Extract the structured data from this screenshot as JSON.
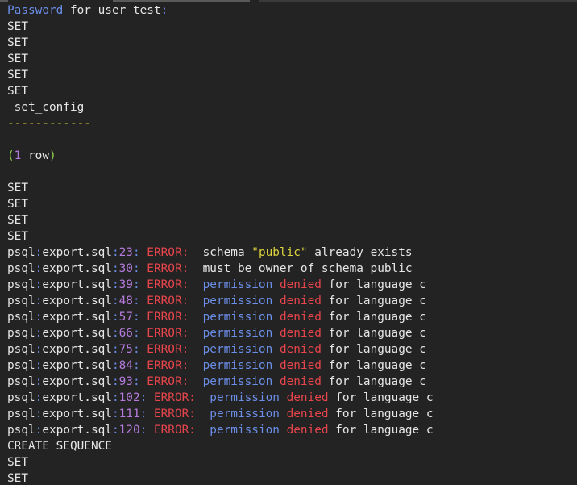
{
  "colors": {
    "background": "#232323",
    "text": "#e6e6e6",
    "keyword_blue": "#6b8ee8",
    "error_red": "#e8454c",
    "number_purple": "#b57bdc",
    "string_yellow": "#d9d23c",
    "paren_green": "#8fd14f"
  },
  "terminal": {
    "lines": [
      [
        {
          "t": "Password",
          "c": "blue"
        },
        {
          "t": " for user test",
          "c": "white"
        },
        {
          "t": ":",
          "c": "blue"
        }
      ],
      [
        {
          "t": "SET",
          "c": "white"
        }
      ],
      [
        {
          "t": "SET",
          "c": "white"
        }
      ],
      [
        {
          "t": "SET",
          "c": "white"
        }
      ],
      [
        {
          "t": "SET",
          "c": "white"
        }
      ],
      [
        {
          "t": "SET",
          "c": "white"
        }
      ],
      [
        {
          "t": " set_config",
          "c": "white"
        }
      ],
      [
        {
          "t": "------------",
          "c": "yellow"
        }
      ],
      [
        {
          "t": " ",
          "c": "white"
        }
      ],
      [
        {
          "t": "(",
          "c": "green"
        },
        {
          "t": "1",
          "c": "purple"
        },
        {
          "t": " row",
          "c": "white"
        },
        {
          "t": ")",
          "c": "green"
        }
      ],
      [
        {
          "t": " ",
          "c": "white"
        }
      ],
      [
        {
          "t": "SET",
          "c": "white"
        }
      ],
      [
        {
          "t": "SET",
          "c": "white"
        }
      ],
      [
        {
          "t": "SET",
          "c": "white"
        }
      ],
      [
        {
          "t": "SET",
          "c": "white"
        }
      ],
      [
        {
          "t": "psql",
          "c": "white"
        },
        {
          "t": ":",
          "c": "blue"
        },
        {
          "t": "export.sql",
          "c": "white"
        },
        {
          "t": ":",
          "c": "blue"
        },
        {
          "t": "23",
          "c": "purple"
        },
        {
          "t": ": ",
          "c": "blue"
        },
        {
          "t": "ERROR",
          "c": "red"
        },
        {
          "t": ":  ",
          "c": "red"
        },
        {
          "t": "schema ",
          "c": "white"
        },
        {
          "t": "\"public\"",
          "c": "yellow"
        },
        {
          "t": " already exists",
          "c": "white"
        }
      ],
      [
        {
          "t": "psql",
          "c": "white"
        },
        {
          "t": ":",
          "c": "blue"
        },
        {
          "t": "export.sql",
          "c": "white"
        },
        {
          "t": ":",
          "c": "blue"
        },
        {
          "t": "30",
          "c": "purple"
        },
        {
          "t": ": ",
          "c": "blue"
        },
        {
          "t": "ERROR",
          "c": "red"
        },
        {
          "t": ":  ",
          "c": "red"
        },
        {
          "t": "must be owner of schema public",
          "c": "white"
        }
      ],
      [
        {
          "t": "psql",
          "c": "white"
        },
        {
          "t": ":",
          "c": "blue"
        },
        {
          "t": "export.sql",
          "c": "white"
        },
        {
          "t": ":",
          "c": "blue"
        },
        {
          "t": "39",
          "c": "purple"
        },
        {
          "t": ": ",
          "c": "blue"
        },
        {
          "t": "ERROR",
          "c": "red"
        },
        {
          "t": ":  ",
          "c": "red"
        },
        {
          "t": "permission",
          "c": "blue"
        },
        {
          "t": " ",
          "c": "white"
        },
        {
          "t": "denied",
          "c": "red"
        },
        {
          "t": " for language c",
          "c": "white"
        }
      ],
      [
        {
          "t": "psql",
          "c": "white"
        },
        {
          "t": ":",
          "c": "blue"
        },
        {
          "t": "export.sql",
          "c": "white"
        },
        {
          "t": ":",
          "c": "blue"
        },
        {
          "t": "48",
          "c": "purple"
        },
        {
          "t": ": ",
          "c": "blue"
        },
        {
          "t": "ERROR",
          "c": "red"
        },
        {
          "t": ":  ",
          "c": "red"
        },
        {
          "t": "permission",
          "c": "blue"
        },
        {
          "t": " ",
          "c": "white"
        },
        {
          "t": "denied",
          "c": "red"
        },
        {
          "t": " for language c",
          "c": "white"
        }
      ],
      [
        {
          "t": "psql",
          "c": "white"
        },
        {
          "t": ":",
          "c": "blue"
        },
        {
          "t": "export.sql",
          "c": "white"
        },
        {
          "t": ":",
          "c": "blue"
        },
        {
          "t": "57",
          "c": "purple"
        },
        {
          "t": ": ",
          "c": "blue"
        },
        {
          "t": "ERROR",
          "c": "red"
        },
        {
          "t": ":  ",
          "c": "red"
        },
        {
          "t": "permission",
          "c": "blue"
        },
        {
          "t": " ",
          "c": "white"
        },
        {
          "t": "denied",
          "c": "red"
        },
        {
          "t": " for language c",
          "c": "white"
        }
      ],
      [
        {
          "t": "psql",
          "c": "white"
        },
        {
          "t": ":",
          "c": "blue"
        },
        {
          "t": "export.sql",
          "c": "white"
        },
        {
          "t": ":",
          "c": "blue"
        },
        {
          "t": "66",
          "c": "purple"
        },
        {
          "t": ": ",
          "c": "blue"
        },
        {
          "t": "ERROR",
          "c": "red"
        },
        {
          "t": ":  ",
          "c": "red"
        },
        {
          "t": "permission",
          "c": "blue"
        },
        {
          "t": " ",
          "c": "white"
        },
        {
          "t": "denied",
          "c": "red"
        },
        {
          "t": " for language c",
          "c": "white"
        }
      ],
      [
        {
          "t": "psql",
          "c": "white"
        },
        {
          "t": ":",
          "c": "blue"
        },
        {
          "t": "export.sql",
          "c": "white"
        },
        {
          "t": ":",
          "c": "blue"
        },
        {
          "t": "75",
          "c": "purple"
        },
        {
          "t": ": ",
          "c": "blue"
        },
        {
          "t": "ERROR",
          "c": "red"
        },
        {
          "t": ":  ",
          "c": "red"
        },
        {
          "t": "permission",
          "c": "blue"
        },
        {
          "t": " ",
          "c": "white"
        },
        {
          "t": "denied",
          "c": "red"
        },
        {
          "t": " for language c",
          "c": "white"
        }
      ],
      [
        {
          "t": "psql",
          "c": "white"
        },
        {
          "t": ":",
          "c": "blue"
        },
        {
          "t": "export.sql",
          "c": "white"
        },
        {
          "t": ":",
          "c": "blue"
        },
        {
          "t": "84",
          "c": "purple"
        },
        {
          "t": ": ",
          "c": "blue"
        },
        {
          "t": "ERROR",
          "c": "red"
        },
        {
          "t": ":  ",
          "c": "red"
        },
        {
          "t": "permission",
          "c": "blue"
        },
        {
          "t": " ",
          "c": "white"
        },
        {
          "t": "denied",
          "c": "red"
        },
        {
          "t": " for language c",
          "c": "white"
        }
      ],
      [
        {
          "t": "psql",
          "c": "white"
        },
        {
          "t": ":",
          "c": "blue"
        },
        {
          "t": "export.sql",
          "c": "white"
        },
        {
          "t": ":",
          "c": "blue"
        },
        {
          "t": "93",
          "c": "purple"
        },
        {
          "t": ": ",
          "c": "blue"
        },
        {
          "t": "ERROR",
          "c": "red"
        },
        {
          "t": ":  ",
          "c": "red"
        },
        {
          "t": "permission",
          "c": "blue"
        },
        {
          "t": " ",
          "c": "white"
        },
        {
          "t": "denied",
          "c": "red"
        },
        {
          "t": " for language c",
          "c": "white"
        }
      ],
      [
        {
          "t": "psql",
          "c": "white"
        },
        {
          "t": ":",
          "c": "blue"
        },
        {
          "t": "export.sql",
          "c": "white"
        },
        {
          "t": ":",
          "c": "blue"
        },
        {
          "t": "102",
          "c": "purple"
        },
        {
          "t": ": ",
          "c": "blue"
        },
        {
          "t": "ERROR",
          "c": "red"
        },
        {
          "t": ":  ",
          "c": "red"
        },
        {
          "t": "permission",
          "c": "blue"
        },
        {
          "t": " ",
          "c": "white"
        },
        {
          "t": "denied",
          "c": "red"
        },
        {
          "t": " for language c",
          "c": "white"
        }
      ],
      [
        {
          "t": "psql",
          "c": "white"
        },
        {
          "t": ":",
          "c": "blue"
        },
        {
          "t": "export.sql",
          "c": "white"
        },
        {
          "t": ":",
          "c": "blue"
        },
        {
          "t": "111",
          "c": "purple"
        },
        {
          "t": ": ",
          "c": "blue"
        },
        {
          "t": "ERROR",
          "c": "red"
        },
        {
          "t": ":  ",
          "c": "red"
        },
        {
          "t": "permission",
          "c": "blue"
        },
        {
          "t": " ",
          "c": "white"
        },
        {
          "t": "denied",
          "c": "red"
        },
        {
          "t": " for language c",
          "c": "white"
        }
      ],
      [
        {
          "t": "psql",
          "c": "white"
        },
        {
          "t": ":",
          "c": "blue"
        },
        {
          "t": "export.sql",
          "c": "white"
        },
        {
          "t": ":",
          "c": "blue"
        },
        {
          "t": "120",
          "c": "purple"
        },
        {
          "t": ": ",
          "c": "blue"
        },
        {
          "t": "ERROR",
          "c": "red"
        },
        {
          "t": ":  ",
          "c": "red"
        },
        {
          "t": "permission",
          "c": "blue"
        },
        {
          "t": " ",
          "c": "white"
        },
        {
          "t": "denied",
          "c": "red"
        },
        {
          "t": " for language c",
          "c": "white"
        }
      ],
      [
        {
          "t": "CREATE SEQUENCE",
          "c": "white"
        }
      ],
      [
        {
          "t": "SET",
          "c": "white"
        }
      ],
      [
        {
          "t": "SET",
          "c": "white"
        }
      ]
    ]
  }
}
